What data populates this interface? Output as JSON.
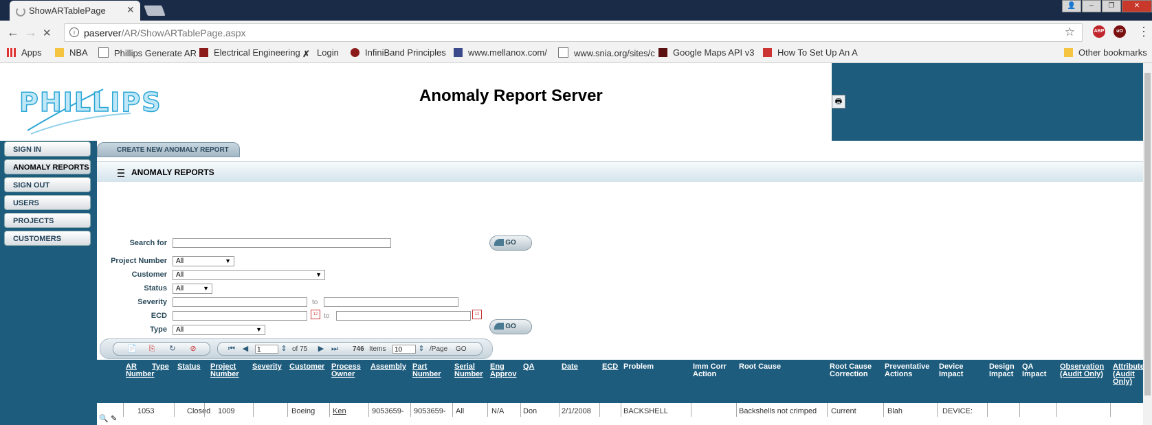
{
  "browser": {
    "tab_title": "ShowARTablePage",
    "url_host": "paserver",
    "url_path": "/AR/ShowARTablePage.aspx",
    "bookmarks": [
      {
        "label": "Apps",
        "icon": "apps-grid-icon"
      },
      {
        "label": "NBA",
        "icon": "folder-icon"
      },
      {
        "label": "Phillips Generate AR",
        "icon": "page-icon"
      },
      {
        "label": "Electrical Engineering",
        "icon": "mit-ocw-icon"
      },
      {
        "label": "Login",
        "icon": "x-logo-icon"
      },
      {
        "label": "InfiniBand Principles",
        "icon": "circle-logo-icon"
      },
      {
        "label": "www.mellanox.com/",
        "icon": "mellanox-icon"
      },
      {
        "label": "www.snia.org/sites/c",
        "icon": "page-icon"
      },
      {
        "label": "Google Maps API v3",
        "icon": "m-logo-icon"
      },
      {
        "label": "How To Set Up An A",
        "icon": "red-logo-icon"
      }
    ],
    "other_bookmarks": "Other bookmarks",
    "extensions": [
      "ABP",
      "uO"
    ]
  },
  "header": {
    "logo_text": "PHILLIPS",
    "title": "Anomaly Report Server"
  },
  "sidebar": {
    "items": [
      {
        "label": "SIGN IN"
      },
      {
        "label": "ANOMALY REPORTS"
      },
      {
        "label": "SIGN OUT"
      },
      {
        "label": "USERS"
      },
      {
        "label": "PROJECTS"
      },
      {
        "label": "CUSTOMERS"
      }
    ]
  },
  "main": {
    "create_button": "CREATE NEW ANOMALY REPORT",
    "section_title": "ANOMALY REPORTS",
    "filters": {
      "search_label": "Search for",
      "search_value": "",
      "project_label": "Project Number",
      "project_value": "All",
      "customer_label": "Customer",
      "customer_value": "All",
      "status_label": "Status",
      "status_value": "All",
      "severity_label": "Severity",
      "ecd_label": "ECD",
      "type_label": "Type",
      "type_value": "All",
      "to_label": "to",
      "go_label": "GO",
      "calendar_text": "12"
    },
    "pager": {
      "page": "1",
      "of_pages": "of 75",
      "items_count": "746",
      "items_label": "Items",
      "page_size": "10",
      "per_page_label": "/Page",
      "go_label": "GO"
    },
    "columns": [
      "AR Number",
      "Type",
      "Status",
      "Project Number",
      "Severity",
      "Customer",
      "Process Owner",
      "Assembly",
      "Part Number",
      "Serial Number",
      "Eng Approv",
      "QA",
      "Date",
      "ECD",
      "Problem",
      "Imm Corr Action",
      "Root Cause",
      "Root Cause Correction",
      "Preventative Actions",
      "Device Impact",
      "Design Impact",
      "QA Impact",
      "Observation (Audit Only)",
      "Attribute (Audit Only)"
    ],
    "row": {
      "ar_number": "1053",
      "status": "Closed",
      "project": "1009",
      "customer": "Boeing",
      "process_owner": "Ken",
      "assembly": "9053659-",
      "part_number": "9053659-",
      "serial": "All",
      "eng_approv": "N/A",
      "qa": "Don",
      "date": "2/1/2008",
      "problem": "BACKSHELL",
      "root_cause": "Backshells not crimped",
      "root_cause_correction": "Current",
      "preventative": "Blah",
      "device_impact": "DEVICE:"
    }
  }
}
